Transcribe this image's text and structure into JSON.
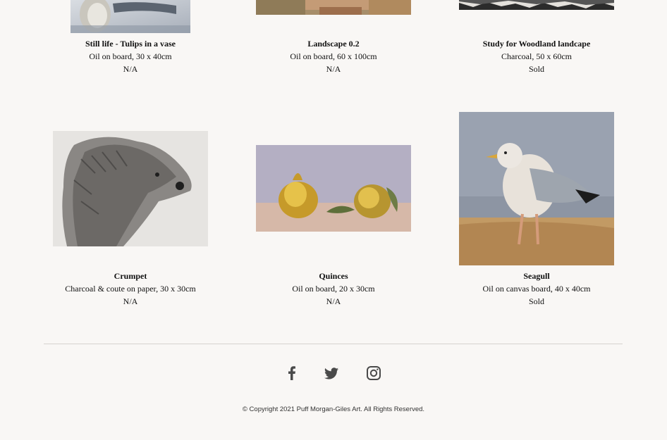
{
  "gallery": {
    "items": [
      {
        "title": "Still life - Tulips in a vase",
        "medium": "Oil on board, 30 x 40cm",
        "status": "N/A"
      },
      {
        "title": "Landscape 0.2",
        "medium": "Oil on board, 60 x 100cm",
        "status": "N/A"
      },
      {
        "title": "Study for Woodland landcape",
        "medium": "Charcoal, 50 x 60cm",
        "status": "Sold"
      },
      {
        "title": "Crumpet",
        "medium": "Charcoal & coute on paper, 30 x 30cm",
        "status": "N/A"
      },
      {
        "title": "Quinces",
        "medium": "Oil on board, 20 x 30cm",
        "status": "N/A"
      },
      {
        "title": "Seagull",
        "medium": "Oil on canvas board, 40 x 40cm",
        "status": "Sold"
      }
    ]
  },
  "social": {
    "icons": [
      "facebook-icon",
      "twitter-icon",
      "instagram-icon"
    ],
    "color": "#4a4a4a"
  },
  "footer": {
    "copyright": "© Copyright 2021 Puff Morgan-Giles Art. All Rights Reserved."
  }
}
